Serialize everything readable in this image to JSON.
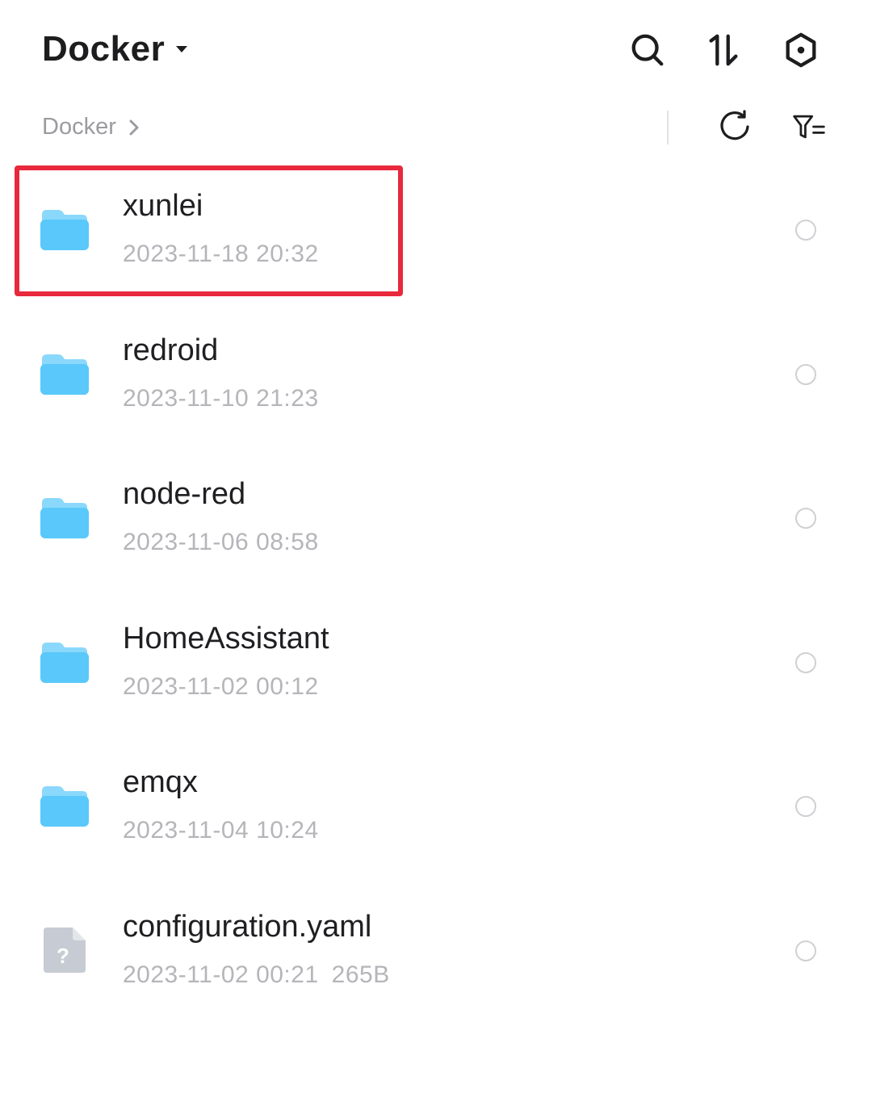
{
  "header": {
    "title": "Docker",
    "actions": [
      {
        "icon": "search-icon"
      },
      {
        "icon": "sort-icon"
      },
      {
        "icon": "settings-hex-icon"
      }
    ]
  },
  "breadcrumb": {
    "items": [
      "Docker"
    ],
    "actions": [
      {
        "icon": "refresh-icon"
      },
      {
        "icon": "filter-icon"
      }
    ]
  },
  "files": [
    {
      "name": "xunlei",
      "date": "2023-11-18 20:32",
      "size": "",
      "type": "folder",
      "icon": "folder-icon",
      "selected": false
    },
    {
      "name": "redroid",
      "date": "2023-11-10 21:23",
      "size": "",
      "type": "folder",
      "icon": "folder-icon",
      "selected": false
    },
    {
      "name": "node-red",
      "date": "2023-11-06 08:58",
      "size": "",
      "type": "folder",
      "icon": "folder-icon",
      "selected": false
    },
    {
      "name": "HomeAssistant",
      "date": "2023-11-02 00:12",
      "size": "",
      "type": "folder",
      "icon": "folder-icon",
      "selected": false
    },
    {
      "name": "emqx",
      "date": "2023-11-04 10:24",
      "size": "",
      "type": "folder",
      "icon": "folder-icon",
      "selected": false
    },
    {
      "name": "configuration.yaml",
      "date": "2023-11-02 00:21",
      "size": "265B",
      "type": "file",
      "icon": "unknown-file-icon",
      "selected": false
    }
  ],
  "colors": {
    "folder": "#5ac8fa",
    "folder_tab": "#8ad8fb",
    "highlight": "#e8283c",
    "secondary_text": "#b5b5ba"
  }
}
